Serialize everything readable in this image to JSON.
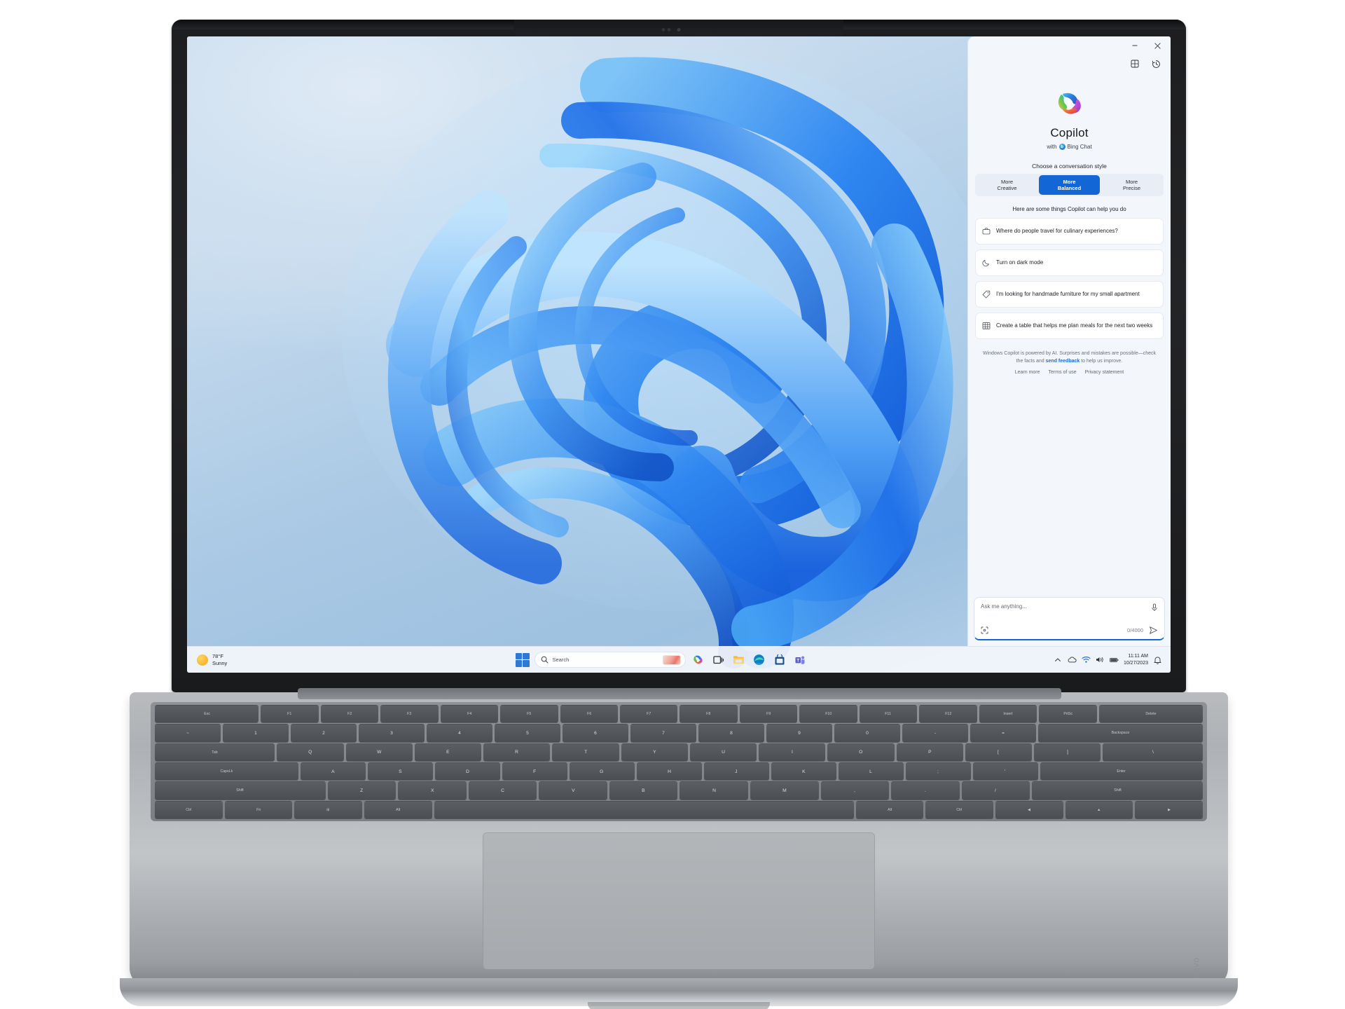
{
  "device": {
    "brand": "Lenovo",
    "webcam_icon": "webcam-icon"
  },
  "desktop": {
    "wallpaper_name": "windows-11-bloom-wallpaper"
  },
  "copilot": {
    "window_controls": [
      {
        "name": "minimize-button",
        "glyph": "–"
      },
      {
        "name": "close-button",
        "glyph": "✕"
      }
    ],
    "toolbar": [
      {
        "name": "apps-grid-button",
        "glyph": "apps-grid-icon"
      },
      {
        "name": "history-button",
        "glyph": "history-icon"
      }
    ],
    "title": "Copilot",
    "subtitle_prefix": "with",
    "subtitle_brand": "Bing Chat",
    "bing_initial": "b",
    "style_label": "Choose a conversation style",
    "styles": [
      {
        "line1": "More",
        "line2": "Creative",
        "selected": false
      },
      {
        "line1": "More",
        "line2": "Balanced",
        "selected": true
      },
      {
        "line1": "More",
        "line2": "Precise",
        "selected": false
      }
    ],
    "accent": "#1366d6",
    "suggestions_heading": "Here are some things Copilot can help you do",
    "suggestions": [
      {
        "icon": "briefcase-icon",
        "text": "Where do people travel for culinary experiences?"
      },
      {
        "icon": "moon-icon",
        "text": "Turn on dark mode"
      },
      {
        "icon": "tag-icon",
        "text": "I'm looking for handmade furniture for my small apartment"
      },
      {
        "icon": "table-icon",
        "text": "Create a table that helps me plan meals for the next two weeks"
      }
    ],
    "disclaimer_part1": "Windows Copilot is powered by AI. Surprises and mistakes are possible—check the facts and ",
    "disclaimer_link": "send feedback",
    "disclaimer_part2": " to help us improve.",
    "links": [
      "Learn more",
      "Terms of use",
      "Privacy statement"
    ],
    "input": {
      "placeholder": "Ask me anything...",
      "mic_icon": "microphone-icon",
      "plugin_icon": "plugins-icon",
      "counter": "0/4000",
      "send_icon": "send-icon"
    }
  },
  "taskbar": {
    "weather": {
      "temperature": "78°F",
      "condition": "Sunny",
      "icon": "sun-icon"
    },
    "start": {
      "name": "start-button",
      "icon": "windows-logo-icon"
    },
    "search": {
      "placeholder": "Search",
      "icon": "search-icon",
      "thumbnail": "search-highlight-thumbnail"
    },
    "apps": [
      {
        "name": "copilot-taskbar-button",
        "icon": "copilot-icon"
      },
      {
        "name": "task-view-button",
        "icon": "task-view-icon"
      },
      {
        "name": "file-explorer-button",
        "icon": "folder-icon"
      },
      {
        "name": "edge-button",
        "icon": "edge-icon"
      },
      {
        "name": "microsoft-store-button",
        "icon": "store-icon"
      },
      {
        "name": "teams-button",
        "icon": "teams-icon"
      }
    ],
    "tray": [
      {
        "name": "show-hidden-icons-button",
        "icon": "chevron-up-icon"
      },
      {
        "name": "onedrive-tray-icon",
        "icon": "cloud-icon"
      },
      {
        "name": "network-tray-icon",
        "icon": "wifi-icon"
      },
      {
        "name": "volume-tray-icon",
        "icon": "speaker-icon"
      },
      {
        "name": "battery-tray-icon",
        "icon": "battery-icon"
      }
    ],
    "clock": {
      "time": "11:11 AM",
      "date": "10/27/2023"
    },
    "notifications": {
      "name": "notification-bell-button",
      "icon": "bell-icon"
    }
  },
  "keyboard": {
    "rows": [
      [
        {
          "t": "Esc",
          "fn": true,
          "w": "w18"
        },
        {
          "t": "F1",
          "fn": true
        },
        {
          "t": "F2",
          "fn": true
        },
        {
          "t": "F3",
          "fn": true
        },
        {
          "t": "F4",
          "fn": true
        },
        {
          "t": "F5",
          "fn": true
        },
        {
          "t": "F6",
          "fn": true
        },
        {
          "t": "F7",
          "fn": true
        },
        {
          "t": "F8",
          "fn": true
        },
        {
          "t": "F9",
          "fn": true
        },
        {
          "t": "F10",
          "fn": true
        },
        {
          "t": "F11",
          "fn": true
        },
        {
          "t": "F12",
          "fn": true
        },
        {
          "t": "Insert",
          "fn": true
        },
        {
          "t": "PrtSc",
          "fn": true
        },
        {
          "t": "Delete",
          "fn": true,
          "w": "w18"
        }
      ],
      [
        {
          "t": "~"
        },
        {
          "t": "1"
        },
        {
          "t": "2"
        },
        {
          "t": "3"
        },
        {
          "t": "4"
        },
        {
          "t": "5"
        },
        {
          "t": "6"
        },
        {
          "t": "7"
        },
        {
          "t": "8"
        },
        {
          "t": "9"
        },
        {
          "t": "0"
        },
        {
          "t": "-"
        },
        {
          "t": "="
        },
        {
          "t": "Backspace",
          "w": "w25",
          "fn": true
        }
      ],
      [
        {
          "t": "Tab",
          "w": "w18",
          "fn": true
        },
        {
          "t": "Q"
        },
        {
          "t": "W"
        },
        {
          "t": "E"
        },
        {
          "t": "R"
        },
        {
          "t": "T"
        },
        {
          "t": "Y"
        },
        {
          "t": "U"
        },
        {
          "t": "I"
        },
        {
          "t": "O"
        },
        {
          "t": "P"
        },
        {
          "t": "["
        },
        {
          "t": "]"
        },
        {
          "t": "\\",
          "w": "w15"
        }
      ],
      [
        {
          "t": "CapsLk",
          "w": "w22",
          "fn": true
        },
        {
          "t": "A"
        },
        {
          "t": "S"
        },
        {
          "t": "D"
        },
        {
          "t": "F"
        },
        {
          "t": "G"
        },
        {
          "t": "H"
        },
        {
          "t": "J"
        },
        {
          "t": "K"
        },
        {
          "t": "L"
        },
        {
          "t": ";"
        },
        {
          "t": "'"
        },
        {
          "t": "Enter",
          "w": "w25",
          "fn": true
        }
      ],
      [
        {
          "t": "Shift",
          "w": "w25",
          "fn": true
        },
        {
          "t": "Z"
        },
        {
          "t": "X"
        },
        {
          "t": "C"
        },
        {
          "t": "V"
        },
        {
          "t": "B"
        },
        {
          "t": "N"
        },
        {
          "t": "M"
        },
        {
          "t": ","
        },
        {
          "t": "."
        },
        {
          "t": "/"
        },
        {
          "t": "Shift",
          "w": "w25",
          "fn": true
        }
      ],
      [
        {
          "t": "Ctrl",
          "fn": true
        },
        {
          "t": "Fn",
          "fn": true
        },
        {
          "t": "⊞",
          "fn": true
        },
        {
          "t": "Alt",
          "fn": true
        },
        {
          "t": "",
          "w": "w60"
        },
        {
          "t": "Alt",
          "fn": true
        },
        {
          "t": "Ctrl",
          "fn": true
        },
        {
          "t": "◀",
          "fn": true
        },
        {
          "t": "▲",
          "fn": true
        },
        {
          "t": "▶",
          "fn": true
        }
      ]
    ]
  }
}
